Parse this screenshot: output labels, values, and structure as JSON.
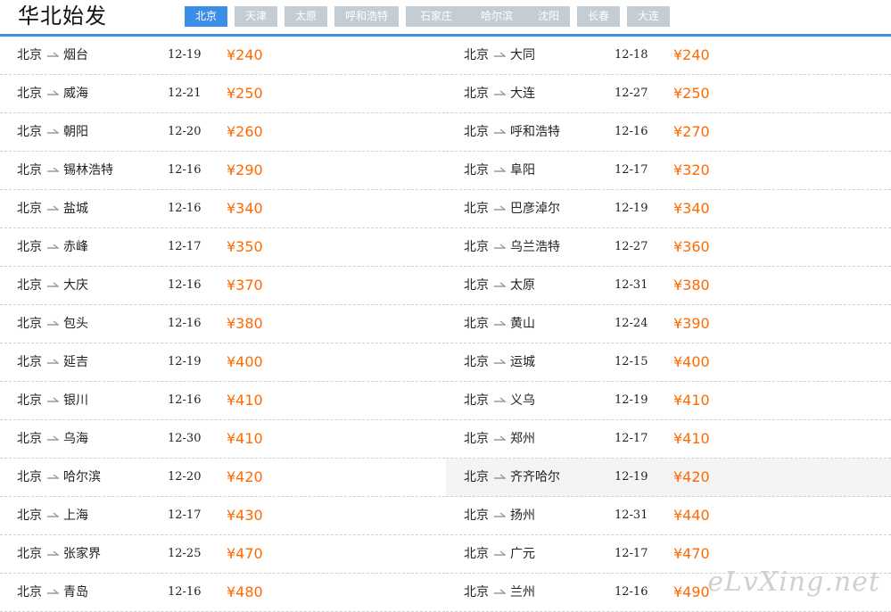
{
  "header": {
    "title": "华北始发",
    "tabs": [
      {
        "label": "北京",
        "active": true
      },
      {
        "label": "天津",
        "active": false
      },
      {
        "label": "太原",
        "active": false
      },
      {
        "label": "呼和浩特",
        "active": false
      },
      {
        "label": "石家庄",
        "active": false
      },
      {
        "label": "哈尔滨",
        "active": false
      },
      {
        "label": "沈阳",
        "active": false
      },
      {
        "label": "长春",
        "active": false
      },
      {
        "label": "大连",
        "active": false
      }
    ]
  },
  "colors": {
    "accent": "#3a8ee6",
    "price": "#ff6a00",
    "tab_inactive": "#c4ccd4"
  },
  "flights": {
    "left": [
      {
        "from": "北京",
        "to": "烟台",
        "date": "12-19",
        "price": "¥240"
      },
      {
        "from": "北京",
        "to": "威海",
        "date": "12-21",
        "price": "¥250"
      },
      {
        "from": "北京",
        "to": "朝阳",
        "date": "12-20",
        "price": "¥260"
      },
      {
        "from": "北京",
        "to": "锡林浩特",
        "date": "12-16",
        "price": "¥290"
      },
      {
        "from": "北京",
        "to": "盐城",
        "date": "12-16",
        "price": "¥340"
      },
      {
        "from": "北京",
        "to": "赤峰",
        "date": "12-17",
        "price": "¥350"
      },
      {
        "from": "北京",
        "to": "大庆",
        "date": "12-16",
        "price": "¥370"
      },
      {
        "from": "北京",
        "to": "包头",
        "date": "12-16",
        "price": "¥380"
      },
      {
        "from": "北京",
        "to": "延吉",
        "date": "12-19",
        "price": "¥400"
      },
      {
        "from": "北京",
        "to": "银川",
        "date": "12-16",
        "price": "¥410"
      },
      {
        "from": "北京",
        "to": "乌海",
        "date": "12-30",
        "price": "¥410"
      },
      {
        "from": "北京",
        "to": "哈尔滨",
        "date": "12-20",
        "price": "¥420"
      },
      {
        "from": "北京",
        "to": "上海",
        "date": "12-17",
        "price": "¥430"
      },
      {
        "from": "北京",
        "to": "张家界",
        "date": "12-25",
        "price": "¥470"
      },
      {
        "from": "北京",
        "to": "青岛",
        "date": "12-16",
        "price": "¥480"
      }
    ],
    "right": [
      {
        "from": "北京",
        "to": "大同",
        "date": "12-18",
        "price": "¥240"
      },
      {
        "from": "北京",
        "to": "大连",
        "date": "12-27",
        "price": "¥250"
      },
      {
        "from": "北京",
        "to": "呼和浩特",
        "date": "12-16",
        "price": "¥270"
      },
      {
        "from": "北京",
        "to": "阜阳",
        "date": "12-17",
        "price": "¥320"
      },
      {
        "from": "北京",
        "to": "巴彦淖尔",
        "date": "12-19",
        "price": "¥340"
      },
      {
        "from": "北京",
        "to": "乌兰浩特",
        "date": "12-27",
        "price": "¥360"
      },
      {
        "from": "北京",
        "to": "太原",
        "date": "12-31",
        "price": "¥380"
      },
      {
        "from": "北京",
        "to": "黄山",
        "date": "12-24",
        "price": "¥390"
      },
      {
        "from": "北京",
        "to": "运城",
        "date": "12-15",
        "price": "¥400"
      },
      {
        "from": "北京",
        "to": "义乌",
        "date": "12-19",
        "price": "¥410"
      },
      {
        "from": "北京",
        "to": "郑州",
        "date": "12-17",
        "price": "¥410"
      },
      {
        "from": "北京",
        "to": "齐齐哈尔",
        "date": "12-19",
        "price": "¥420",
        "hovered": true
      },
      {
        "from": "北京",
        "to": "扬州",
        "date": "12-31",
        "price": "¥440"
      },
      {
        "from": "北京",
        "to": "广元",
        "date": "12-17",
        "price": "¥470"
      },
      {
        "from": "北京",
        "to": "兰州",
        "date": "12-16",
        "price": "¥490"
      }
    ]
  },
  "watermark": "eLvXing.net"
}
